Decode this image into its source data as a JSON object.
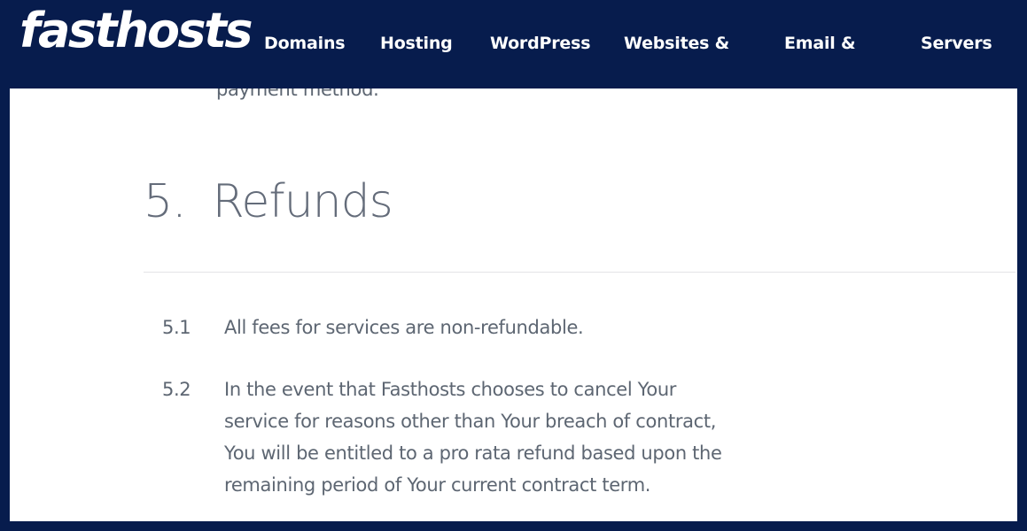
{
  "colors": {
    "brand_navy": "#071c4d",
    "body_text": "#5d6672",
    "heading_text": "#646c7a",
    "divider": "#e3e4e7",
    "page_background": "#ffffff"
  },
  "header": {
    "logo_text": "fasthosts",
    "nav": [
      {
        "label": "Domains"
      },
      {
        "label": "Hosting"
      },
      {
        "label": "WordPress"
      },
      {
        "label": "Websites &"
      },
      {
        "label": "Email &"
      },
      {
        "label": "Servers"
      }
    ]
  },
  "content": {
    "clipped_paragraph_tail": "payment method.",
    "section": {
      "number": "5.",
      "title": "Refunds"
    },
    "clauses": [
      {
        "number": "5.1",
        "text": "All fees for services are non-refundable."
      },
      {
        "number": "5.2",
        "text": "In the event that Fasthosts chooses to cancel Your service for reasons other than Your breach of contract, You will be entitled to a pro rata refund based upon the remaining period of Your current contract term."
      }
    ]
  }
}
